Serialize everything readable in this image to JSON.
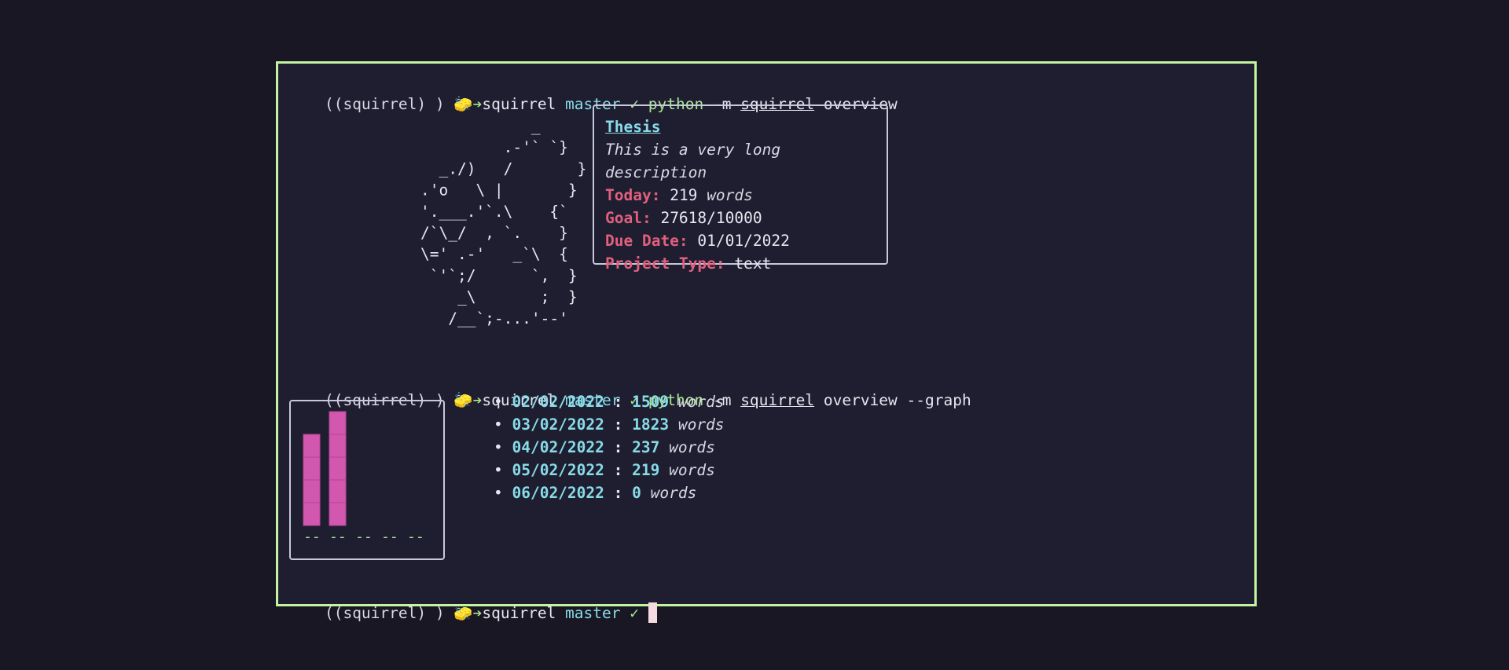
{
  "prompt": {
    "env": "((squirrel) )",
    "emoji": "🧽",
    "arrow": "➔",
    "dir": "squirrel",
    "branch": "master",
    "check": "✓"
  },
  "commands": [
    {
      "program": "python",
      "flag": "-m",
      "module": "squirrel",
      "args": "overview"
    },
    {
      "program": "python",
      "flag": "-m",
      "module": "squirrel",
      "args": "overview --graph"
    }
  ],
  "ascii_art": [
    "            _",
    "         .-'` `}",
    "  _./)   /       }",
    ".'o   \\ |       }",
    "'.___.'`.\\    {`",
    "/`\\_/  , `.    }",
    "\\=' .-'   _`\\  {",
    " `'`;/      `,  }",
    "    _\\       ;  }",
    "   /__`;-...'--'"
  ],
  "project": {
    "title": "Thesis",
    "description": "This is a very long description",
    "today_label": "Today:",
    "today_value": "219",
    "today_unit": "words",
    "goal_label": "Goal:",
    "goal_value": "27618/10000",
    "due_label": "Due Date:",
    "due_value": "01/01/2022",
    "type_label": "Project Type:",
    "type_value": "text"
  },
  "chart_data": {
    "type": "bar",
    "categories": [
      "02/02/2022",
      "03/02/2022",
      "04/02/2022",
      "05/02/2022",
      "06/02/2022"
    ],
    "values": [
      1509,
      1823,
      237,
      219,
      0
    ],
    "colors": {
      "bar": "#d257ae",
      "baseline": "#a8e890"
    }
  },
  "history": {
    "unit": "words",
    "items": [
      {
        "date": "02/02/2022",
        "count": "1509"
      },
      {
        "date": "03/02/2022",
        "count": "1823"
      },
      {
        "date": "04/02/2022",
        "count": "237"
      },
      {
        "date": "05/02/2022",
        "count": "219"
      },
      {
        "date": "06/02/2022",
        "count": "0"
      }
    ]
  },
  "colors": {
    "background": "#181723",
    "terminal_bg": "#1f1e30",
    "border": "#c3f4a0",
    "cyan": "#88dbe8",
    "green": "#a8e890",
    "pink": "#e0607e",
    "bar": "#d257ae"
  }
}
